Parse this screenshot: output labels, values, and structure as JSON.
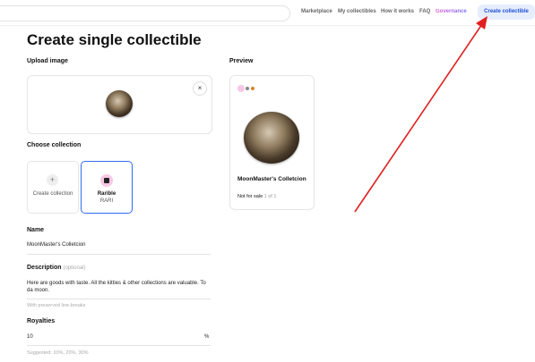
{
  "nav": {
    "search_placeholder": "",
    "links": [
      "Marketplace",
      "My collectibles",
      "How it works",
      "FAQ",
      "Governance"
    ],
    "create_button": "Create collectible"
  },
  "page": {
    "title": "Create single collectible"
  },
  "upload": {
    "label": "Upload image",
    "close": "×"
  },
  "collection": {
    "label": "Choose collection",
    "create_label": "Create collection",
    "rarible_name": "Rarible",
    "rarible_ticker": "RARI"
  },
  "name_field": {
    "label": "Name",
    "value": "MoonMaster's Colletcion"
  },
  "description_field": {
    "label": "Description",
    "optional": "(optional)",
    "value": "Here  are goods with taste. All the kitties & other collections are valuable. To da moon.",
    "hint": "With preserved line-breaks"
  },
  "royalties_field": {
    "label": "Royalties",
    "value": "10",
    "unit": "%",
    "hint": "Suggested: 10%, 20%, 30%"
  },
  "preview": {
    "label": "Preview",
    "card_title": "MoonMaster's Colletcion",
    "status": "Not for sale",
    "quantity": "1 of 1"
  },
  "colors": {
    "accent": "#2f6cf0",
    "create_button_bg": "#e6eefc",
    "arrow": "#e02020",
    "rarible_pink": "#f6c8e4"
  }
}
